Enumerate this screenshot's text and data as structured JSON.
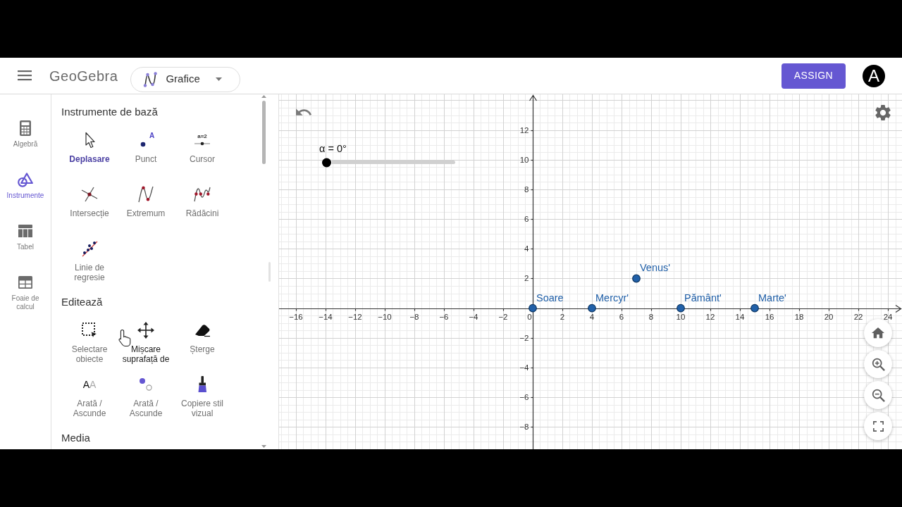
{
  "header": {
    "logo": "GeoGebra",
    "app_switcher": "Grafice",
    "assign_button": "ASSIGN",
    "avatar": "A"
  },
  "rail": [
    {
      "kind": "calculator",
      "label": "Algebră",
      "selected": false
    },
    {
      "kind": "tools",
      "label": "Instrumente",
      "selected": true
    },
    {
      "kind": "table",
      "label": "Tabel",
      "selected": false
    },
    {
      "kind": "spreadsheet",
      "label": "Foaie de calcul",
      "selected": false
    }
  ],
  "tool_groups": [
    {
      "title": "Instrumente de bază",
      "tools": [
        {
          "kind": "move",
          "label": "Deplasare",
          "selected": true,
          "hovered": false
        },
        {
          "kind": "point",
          "icon_text": "A",
          "label": "Punct",
          "selected": false,
          "hovered": false
        },
        {
          "kind": "slider",
          "icon_text": "a=2",
          "label": "Cursor",
          "selected": false,
          "hovered": false
        },
        {
          "kind": "intersect",
          "label": "Intersecție",
          "selected": false,
          "hovered": false
        },
        {
          "kind": "extremum",
          "label": "Extremum",
          "selected": false,
          "hovered": false
        },
        {
          "kind": "roots",
          "label": "Rădăcini",
          "selected": false,
          "hovered": false
        },
        {
          "kind": "regression",
          "label": "Linie de regresie",
          "selected": false,
          "hovered": false
        }
      ]
    },
    {
      "title": "Editează",
      "tools": [
        {
          "kind": "select",
          "label": "Selectare obiecte",
          "selected": false,
          "hovered": false
        },
        {
          "kind": "pan",
          "label": "Mișcare suprafață de",
          "selected": false,
          "hovered": true
        },
        {
          "kind": "delete",
          "label": "Șterge",
          "selected": false,
          "hovered": false
        },
        {
          "kind": "show_label",
          "icon_text": "AA",
          "label": "Arată / Ascunde",
          "selected": false,
          "hovered": false
        },
        {
          "kind": "show_object",
          "label": "Arată / Ascunde",
          "selected": false,
          "hovered": false
        },
        {
          "kind": "copy_style",
          "label": "Copiere stil vizual",
          "selected": false,
          "hovered": false
        }
      ]
    },
    {
      "title": "Media"
    }
  ],
  "graphics": {
    "slider": {
      "label": "α = 0°",
      "level": 0
    },
    "chart_data": {
      "type": "scatter",
      "series": [
        {
          "name": "Soare",
          "color": "#2160a8",
          "x": [
            0
          ],
          "values": [
            0
          ]
        },
        {
          "name": "Mercyr'",
          "color": "#2160a8",
          "x": [
            4
          ],
          "values": [
            0
          ]
        },
        {
          "name": "Venus'",
          "color": "#2160a8",
          "x": [
            7
          ],
          "values": [
            2
          ]
        },
        {
          "name": "Pământ'",
          "color": "#2160a8",
          "x": [
            10
          ],
          "values": [
            0
          ]
        },
        {
          "name": "Marte'",
          "color": "#2160a8",
          "x": [
            15
          ],
          "values": [
            0
          ]
        }
      ],
      "xlim": [
        -17.14,
        24.95
      ],
      "ylim": [
        -9.5,
        14.4
      ],
      "xticks": [
        -16,
        -14,
        -12,
        -10,
        -8,
        -6,
        -4,
        -2,
        0,
        2,
        4,
        6,
        8,
        10,
        12,
        14,
        16,
        18,
        20,
        22,
        24
      ],
      "yticks": [
        -8,
        -6,
        -4,
        -2,
        2,
        4,
        6,
        8,
        10,
        12
      ],
      "grid": true
    }
  }
}
